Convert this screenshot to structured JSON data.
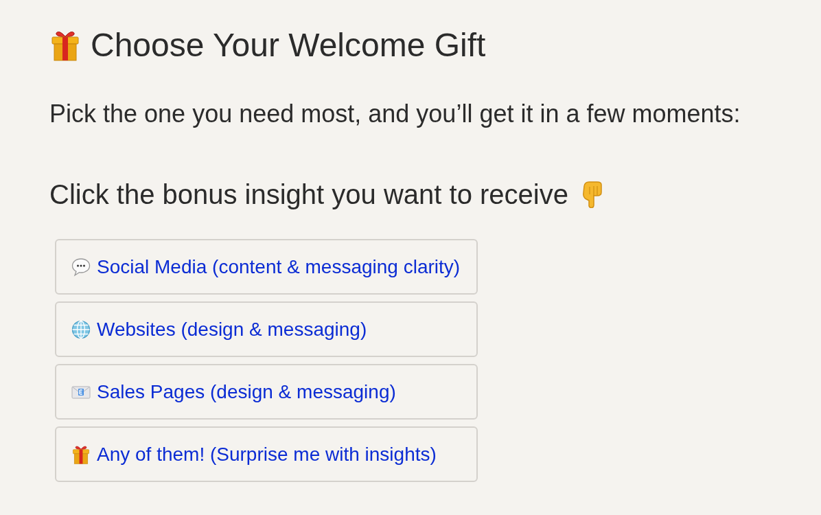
{
  "heading": {
    "text": "Choose Your Welcome Gift"
  },
  "intro": "Pick the one you need most, and you’ll get it in a few moments:",
  "prompt": "Click the bonus insight you want to receive",
  "options": [
    {
      "kind": "social",
      "label": "Social Media (content & messaging clarity)"
    },
    {
      "kind": "websites",
      "label": "Websites (design & messaging)"
    },
    {
      "kind": "sales",
      "label": "Sales Pages (design & messaging)"
    },
    {
      "kind": "any",
      "label": "Any of them! (Surprise me with insights)"
    }
  ]
}
